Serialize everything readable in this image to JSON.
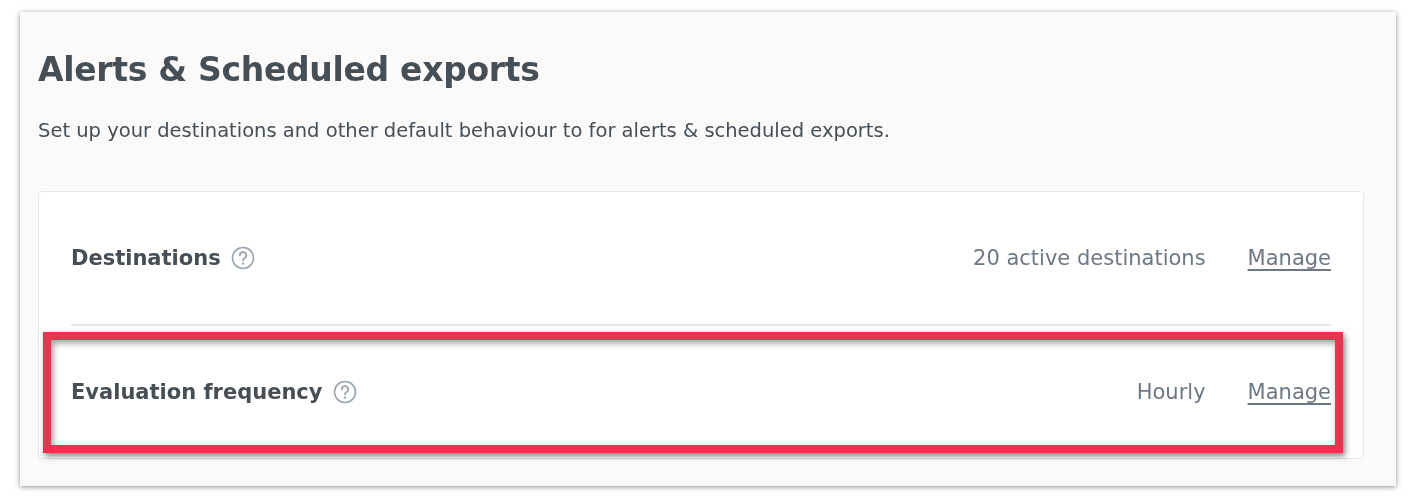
{
  "title": "Alerts & Scheduled exports",
  "description": "Set up your destinations and other default behaviour to for alerts & scheduled exports.",
  "settings": [
    {
      "label": "Destinations",
      "value": "20 active destinations",
      "action": "Manage",
      "highlighted": false
    },
    {
      "label": "Evaluation frequency",
      "value": "Hourly",
      "action": "Manage",
      "highlighted": true
    }
  ]
}
